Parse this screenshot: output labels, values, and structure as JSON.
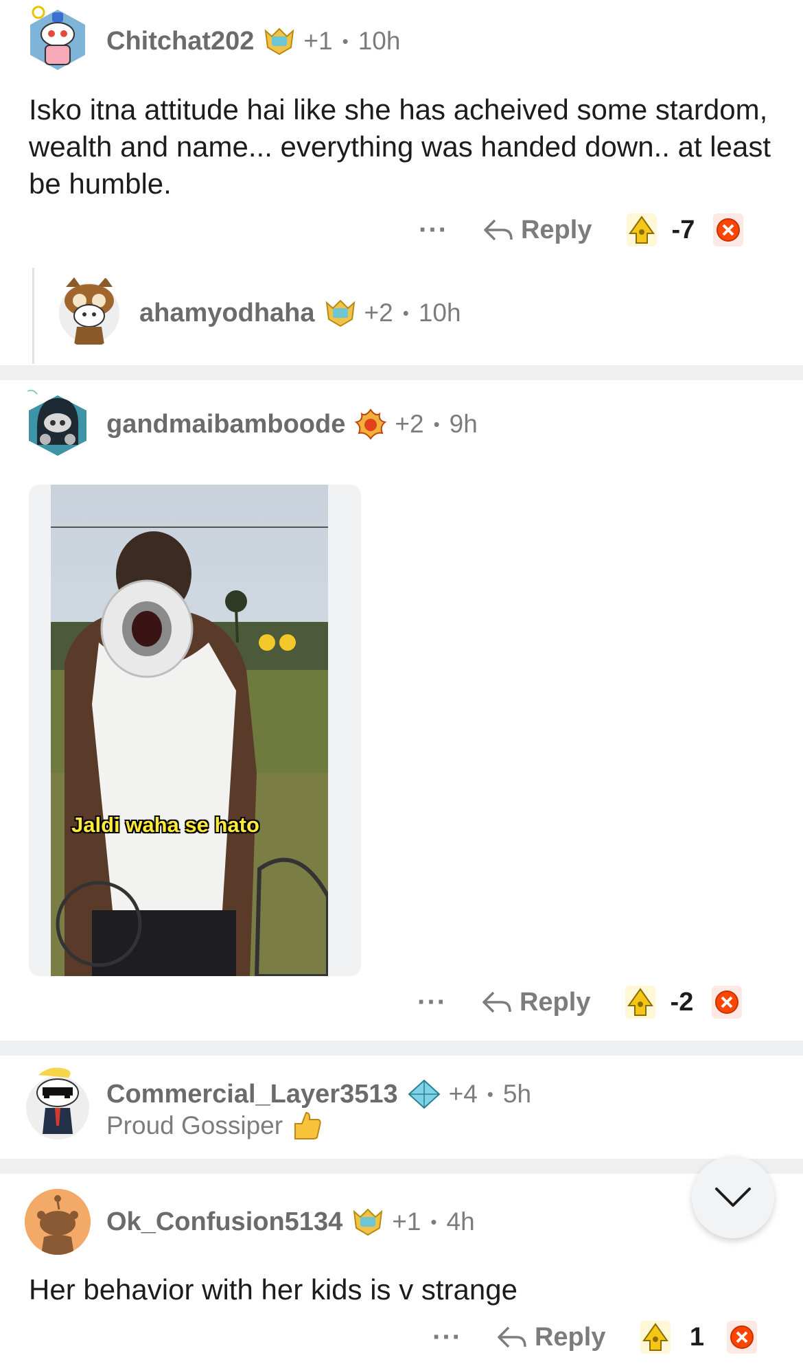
{
  "comments": [
    {
      "username": "Chitchat202",
      "karma": "+1",
      "time": "10h",
      "body": "Isko itna attitude hai like she has acheived some stardom, wealth and name... everything was handed down.. at least be humble.",
      "more_label": "···",
      "reply_label": "Reply",
      "score": "-7",
      "avatar_icon": "snoo-robot-avatar-icon",
      "badge_icon": "crown-shield-badge-icon"
    },
    {
      "username": "ahamyodhaha",
      "karma": "+2",
      "time": "10h",
      "avatar_icon": "owl-costume-snoo-avatar-icon",
      "badge_icon": "crown-shield-badge-icon"
    },
    {
      "username": "gandmaibamboode",
      "karma": "+2",
      "time": "9h",
      "media_caption": "Jaldi waha se hato",
      "more_label": "···",
      "reply_label": "Reply",
      "score": "-2",
      "avatar_icon": "hooded-snoo-avatar-icon",
      "badge_icon": "flame-badge-icon"
    },
    {
      "username": "Commercial_Layer3513",
      "karma": "+4",
      "time": "5h",
      "flair": "Proud Gossiper",
      "avatar_icon": "sunglasses-snoo-avatar-icon",
      "badge_icon": "diamond-badge-icon"
    },
    {
      "username": "Ok_Confusion5134",
      "karma": "+1",
      "time": "4h",
      "body": "Her behavior with her kids is v strange",
      "more_label": "···",
      "reply_label": "Reply",
      "score": "1",
      "avatar_icon": "default-snoo-avatar-icon",
      "badge_icon": "crown-shield-badge-icon"
    }
  ],
  "colors": {
    "upvote": "#f5c518",
    "downvote": "#ff4500",
    "muted": "#7c7c7c",
    "separator": "#edeff1"
  }
}
